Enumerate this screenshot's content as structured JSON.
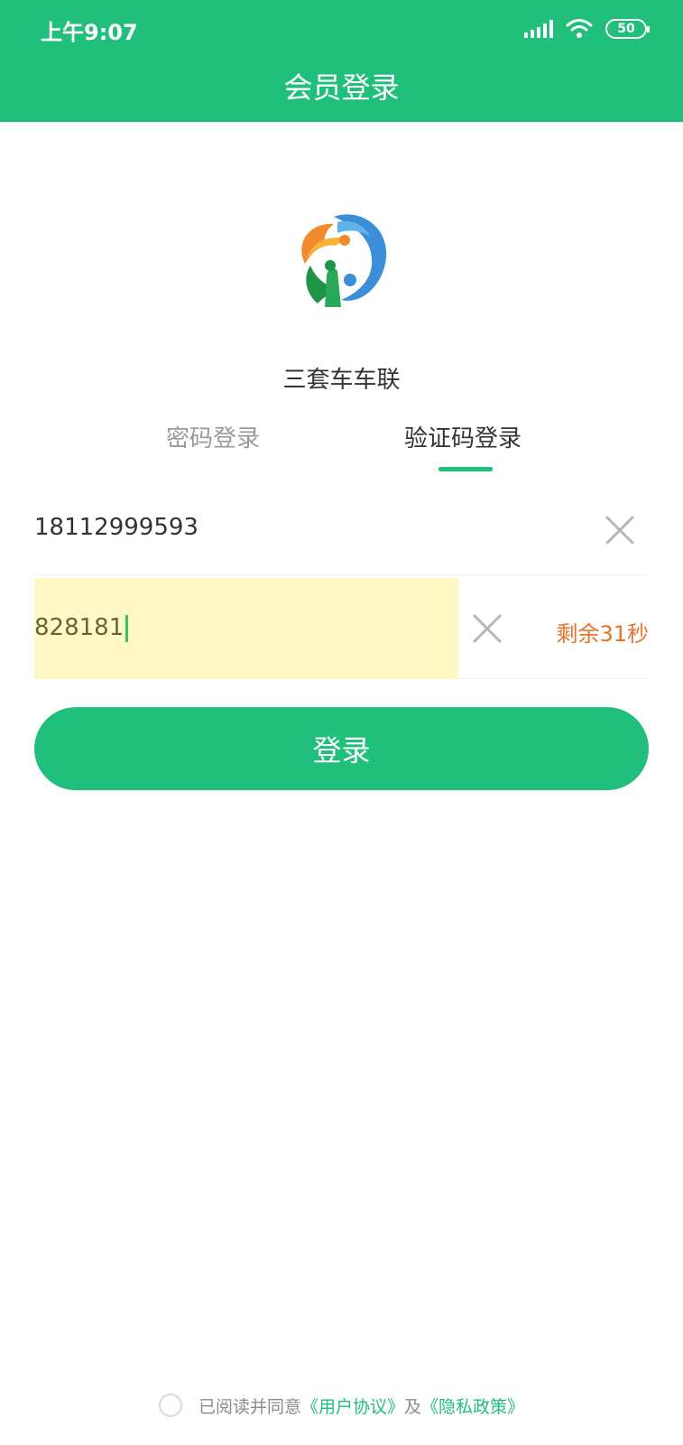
{
  "status_bar": {
    "time": "上午9:07",
    "battery": "50"
  },
  "header": {
    "title": "会员登录"
  },
  "app": {
    "name": "三套车车联"
  },
  "tabs": [
    {
      "label": "密码登录",
      "active": false
    },
    {
      "label": "验证码登录",
      "active": true
    }
  ],
  "form": {
    "phone_value": "18112999593",
    "code_value": "828181",
    "countdown": "剩余31秒",
    "submit_label": "登录"
  },
  "agreement": {
    "prefix": "已阅读并同意",
    "user_agreement": "《用户协议》",
    "conjunction": "及",
    "privacy_policy": "《隐私政策》"
  },
  "colors": {
    "brand": "#20bf7b",
    "countdown": "#e8732b",
    "code_field_bg": "#fff9c6"
  }
}
